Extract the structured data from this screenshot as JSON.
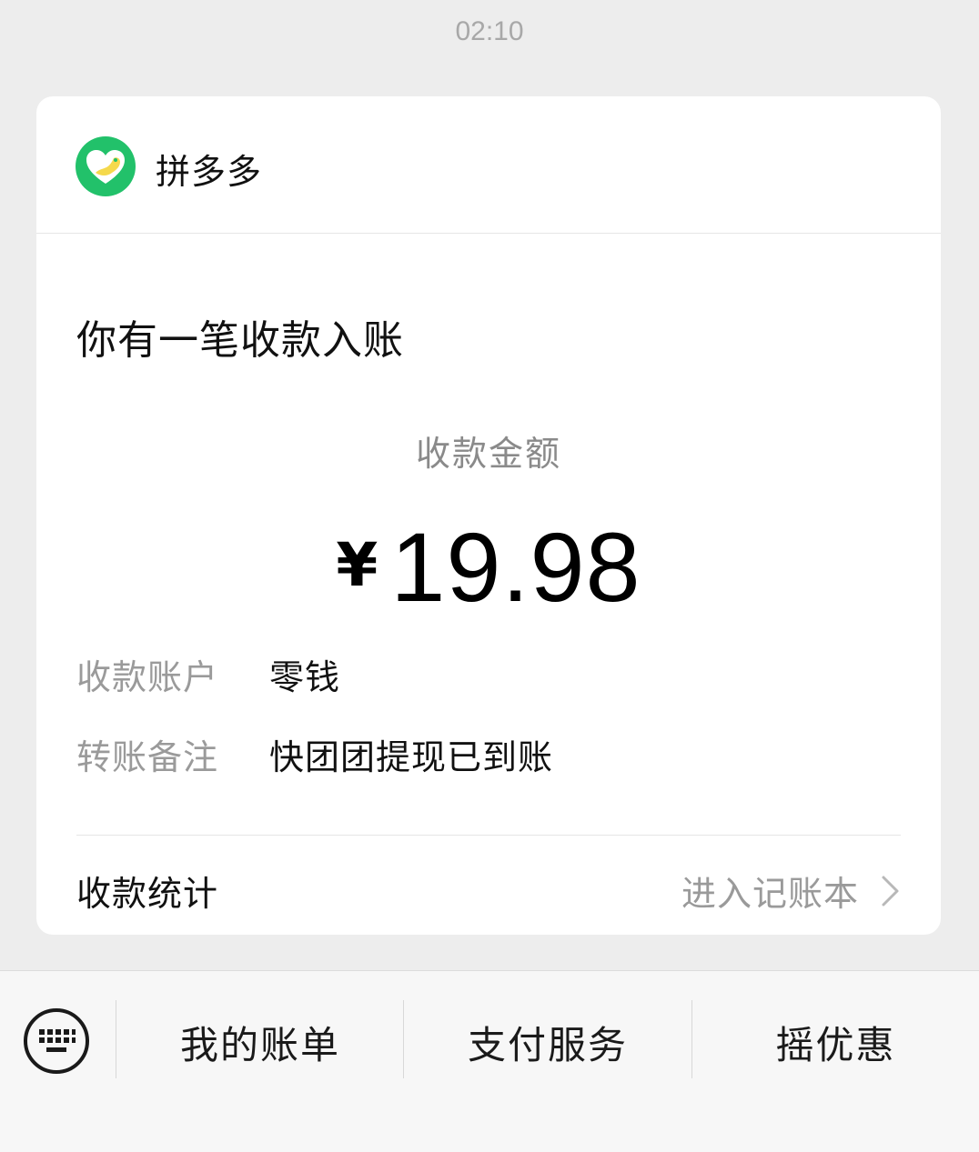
{
  "timestamp": "02:10",
  "card": {
    "app_name": "拼多多",
    "title": "你有一笔收款入账",
    "amount_label": "收款金额",
    "currency": "¥",
    "amount": "19.98",
    "details": [
      {
        "label": "收款账户",
        "value": "零钱"
      },
      {
        "label": "转账备注",
        "value": "快团团提现已到账"
      }
    ],
    "stats_label": "收款统计",
    "stats_link": "进入记账本"
  },
  "bottom_menu": {
    "items": [
      "我的账单",
      "支付服务",
      "摇优惠"
    ]
  },
  "colors": {
    "logo_green": "#22c16a",
    "logo_yellow": "#f5d94c"
  }
}
